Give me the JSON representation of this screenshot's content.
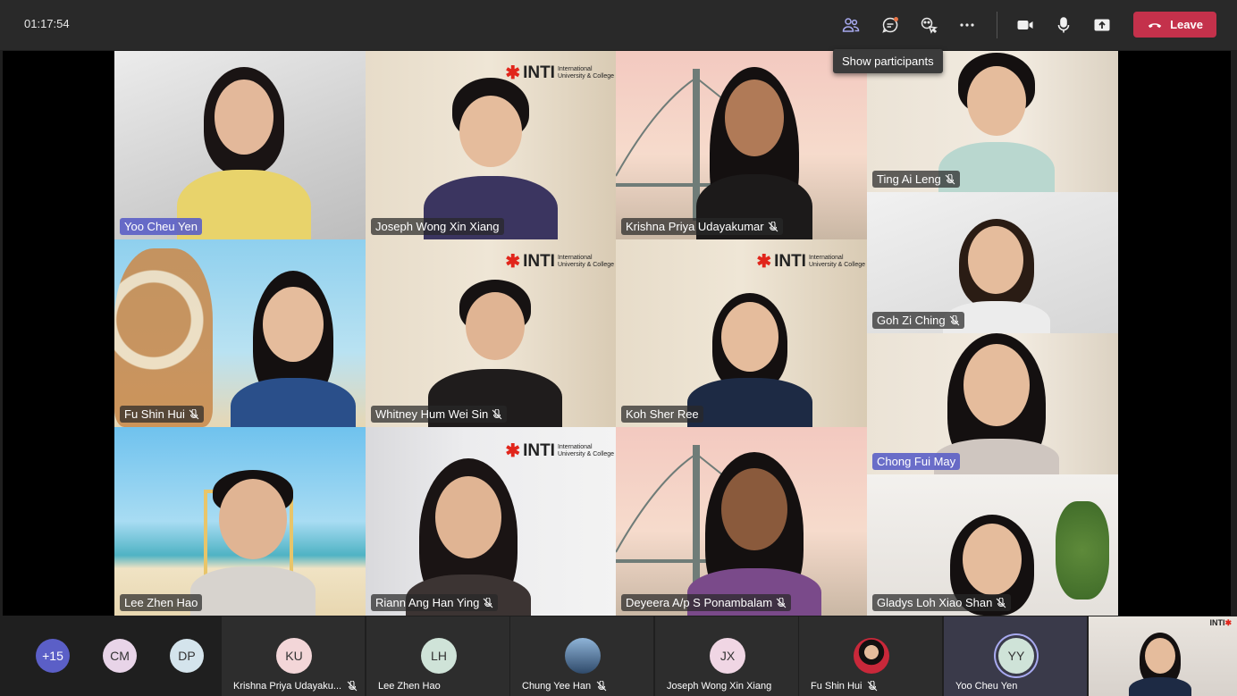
{
  "meeting": {
    "timer": "01:17:54",
    "tooltip": "Show participants",
    "leave_label": "Leave"
  },
  "toolbar": {
    "icons": [
      "people-icon",
      "chat-icon",
      "reactions-icon",
      "more-icon",
      "camera-icon",
      "mic-icon",
      "share-icon",
      "phone-hangup-icon"
    ]
  },
  "logo": {
    "brand": "INTI",
    "line1": "International",
    "line2": "University & College"
  },
  "tiles": [
    {
      "name": "Yoo Cheu Yen",
      "muted": false,
      "active": true
    },
    {
      "name": "Joseph Wong Xin Xiang",
      "muted": false,
      "active": false
    },
    {
      "name": "Krishna Priya Udayakumar",
      "muted": true,
      "active": false
    },
    {
      "name": "Ting Ai Leng",
      "muted": true,
      "active": false
    },
    {
      "name": "Goh Zi Ching",
      "muted": true,
      "active": false
    },
    {
      "name": "Fu Shin Hui",
      "muted": true,
      "active": false
    },
    {
      "name": "Whitney Hum Wei Sin",
      "muted": true,
      "active": false
    },
    {
      "name": "Koh Sher Ree",
      "muted": false,
      "active": false
    },
    {
      "name": "Chong Fui May",
      "muted": false,
      "active": true
    },
    {
      "name": "Lee Zhen Hao",
      "muted": false,
      "active": false
    },
    {
      "name": "Riann Ang Han Ying",
      "muted": true,
      "active": false
    },
    {
      "name": "Deyeera A/p S Ponambalam",
      "muted": true,
      "active": false
    },
    {
      "name": "Gladys Loh Xiao Shan",
      "muted": true,
      "active": false
    }
  ],
  "bottom": {
    "overflow_count": "+15",
    "circles": [
      {
        "initials": "CM",
        "color": "#e8d4e8"
      },
      {
        "initials": "DP",
        "color": "#d4e4ec"
      }
    ],
    "participants": [
      {
        "initials": "KU",
        "name": "Krishna Priya Udayaku...",
        "muted": true,
        "color": "#f3d6d8"
      },
      {
        "initials": "LH",
        "name": "Lee Zhen Hao",
        "muted": false,
        "color": "#cfe3d8"
      },
      {
        "initials": "",
        "name": "Chung Yee Han",
        "muted": true,
        "color": "#6a8aa8"
      },
      {
        "initials": "JX",
        "name": "Joseph Wong Xin Xiang",
        "muted": false,
        "color": "#f0d6e4"
      },
      {
        "initials": "",
        "name": "Fu Shin Hui",
        "muted": true,
        "color": "#e9e4e0"
      },
      {
        "initials": "YY",
        "name": "Yoo Cheu Yen",
        "muted": false,
        "color": "#cfe3d8"
      }
    ]
  }
}
